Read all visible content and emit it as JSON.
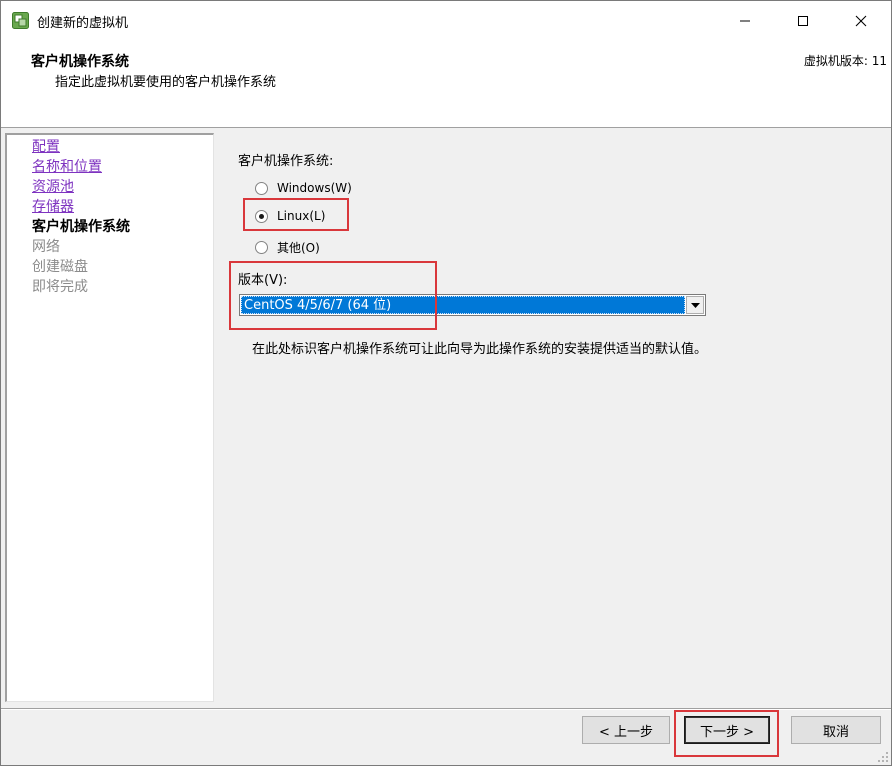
{
  "window": {
    "title": "创建新的虚拟机",
    "icon": "vsphere-logo-icon"
  },
  "header": {
    "title": "客户机操作系统",
    "subtitle": "指定此虚拟机要使用的客户机操作系统",
    "version": "虚拟机版本: 11"
  },
  "nav": {
    "items": [
      {
        "label": "配置",
        "state": "link"
      },
      {
        "label": "名称和位置",
        "state": "link"
      },
      {
        "label": "资源池",
        "state": "link"
      },
      {
        "label": "存储器",
        "state": "link"
      },
      {
        "label": "客户机操作系统",
        "state": "current"
      },
      {
        "label": "网络",
        "state": "disabled"
      },
      {
        "label": "创建磁盘",
        "state": "disabled"
      },
      {
        "label": "即将完成",
        "state": "disabled"
      }
    ]
  },
  "main": {
    "os_label": "客户机操作系统:",
    "os_options": [
      {
        "label": "Windows(W)",
        "checked": false
      },
      {
        "label": "Linux(L)",
        "checked": true
      },
      {
        "label": "其他(O)",
        "checked": false
      }
    ],
    "version_label": "版本(V):",
    "version_value": "CentOS 4/5/6/7 (64 位)",
    "hint": "在此处标识客户机操作系统可让此向导为此操作系统的安装提供适当的默认值。"
  },
  "footer": {
    "back_label": "< 上一步",
    "next_label": "下一步 >",
    "cancel_label": "取消"
  },
  "colors": {
    "annotation": "#d9373b",
    "link": "#7e33c0",
    "selection": "#0078d7"
  }
}
